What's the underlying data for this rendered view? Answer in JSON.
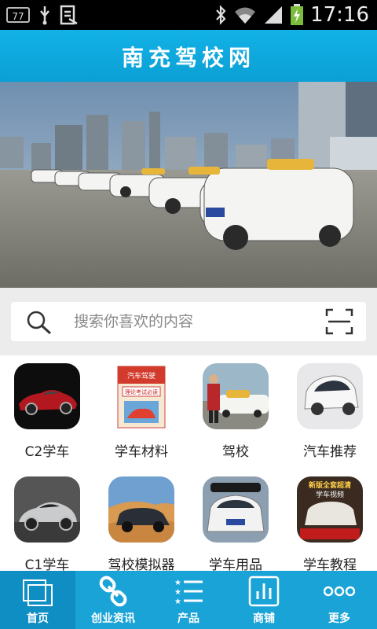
{
  "status_bar": {
    "battery_badge": "77",
    "time": "17:16"
  },
  "header": {
    "title": "南充驾校网"
  },
  "banner": {
    "slide_count": 5,
    "active_slide": 4
  },
  "search": {
    "placeholder": "搜索你喜欢的内容"
  },
  "categories": [
    {
      "label": "C2学车"
    },
    {
      "label": "学车材料"
    },
    {
      "label": "驾校"
    },
    {
      "label": "汽车推荐"
    },
    {
      "label": "C1学车"
    },
    {
      "label": "驾校模拟器"
    },
    {
      "label": "学车用品"
    },
    {
      "label": "学车教程"
    }
  ],
  "thumbnail_text": {
    "book": [
      "汽车驾驶",
      "理论考试必读"
    ],
    "tutorial": [
      "新版全套超清",
      "学车视频"
    ]
  },
  "tabs": [
    {
      "label": "首页",
      "icon": "home-icon",
      "active": true
    },
    {
      "label": "创业资讯",
      "icon": "link-icon",
      "active": false
    },
    {
      "label": "产品",
      "icon": "list-icon",
      "active": false
    },
    {
      "label": "商铺",
      "icon": "chart-icon",
      "active": false
    },
    {
      "label": "更多",
      "icon": "more-icon",
      "active": false
    }
  ],
  "colors": {
    "accent": "#12b2e6",
    "tabbar": "#1aa3d6"
  }
}
